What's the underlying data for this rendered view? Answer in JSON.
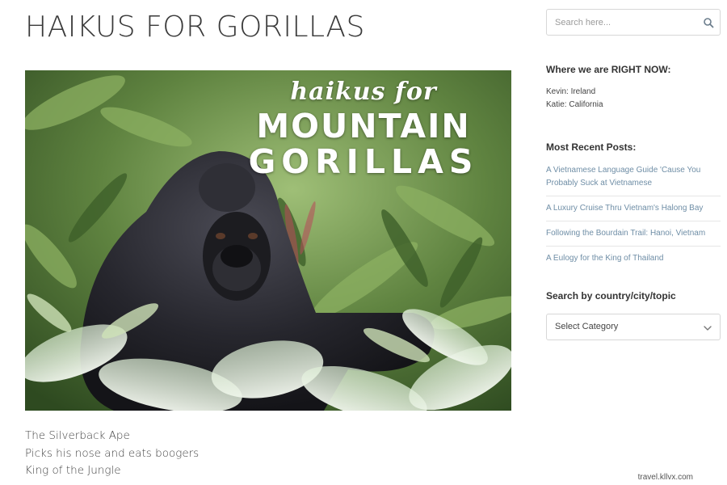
{
  "post": {
    "title": "HAIKUS FOR GORILLAS",
    "hero": {
      "kicker": "haikus for",
      "headline_line1": "MOUNTAIN",
      "headline_line2": "GORILLAS"
    },
    "haiku": [
      "The Silverback Ape",
      "Picks his nose and eats boogers",
      "King of the Jungle"
    ]
  },
  "watermark": "travel.kllvx.com",
  "sidebar": {
    "search": {
      "placeholder": "Search here...",
      "icon": "search-icon"
    },
    "location_widget": {
      "title": "Where we are RIGHT NOW:",
      "lines": [
        "Kevin: Ireland",
        "Katie: California"
      ]
    },
    "recent_posts_widget": {
      "title": "Most Recent Posts:",
      "posts": [
        "A Vietnamese Language Guide 'Cause You Probably Suck at Vietnamese",
        "A Luxury Cruise Thru Vietnam's Halong Bay",
        "Following the Bourdain Trail: Hanoi, Vietnam",
        "A Eulogy for the King of Thailand"
      ]
    },
    "category_widget": {
      "title": "Search by country/city/topic",
      "selected": "Select Category",
      "icon": "chevron-down-icon"
    }
  },
  "colors": {
    "link": "#6f8ea6",
    "foliage": "#4c6a35",
    "border": "#d7d7d7"
  }
}
